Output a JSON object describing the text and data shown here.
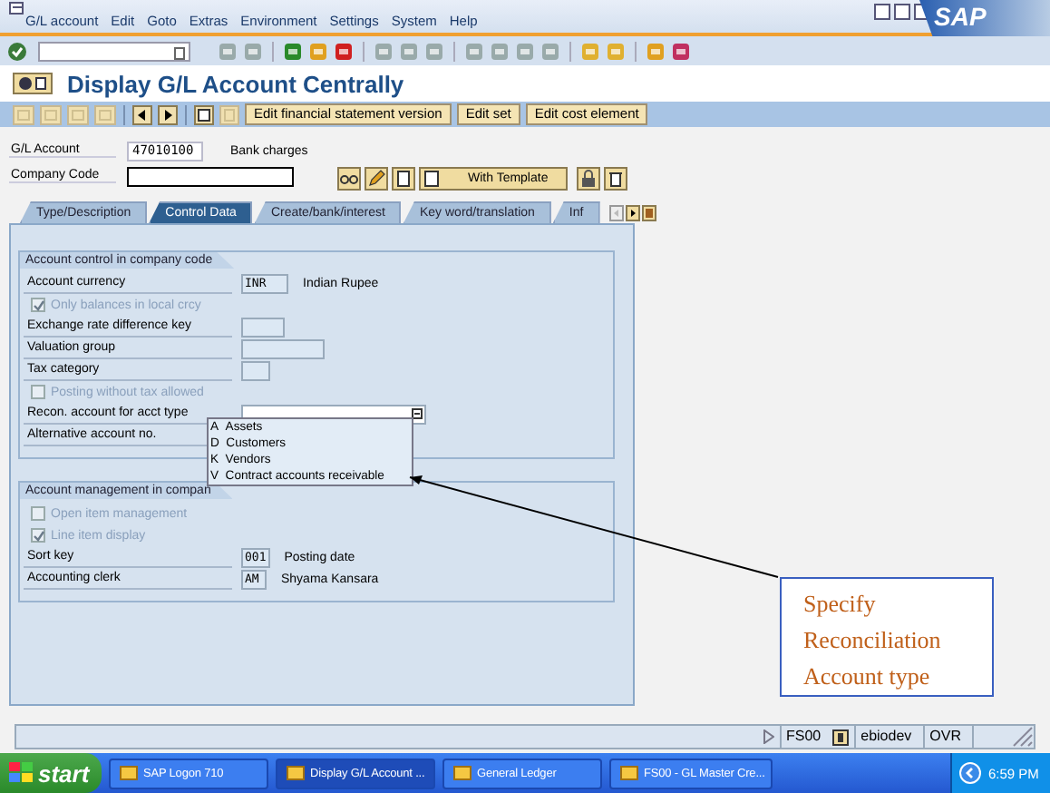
{
  "window": {
    "menu": [
      "G/L account",
      "Edit",
      "Goto",
      "Extras",
      "Environment",
      "Settings",
      "System",
      "Help"
    ],
    "logo": "SAP",
    "title": "Display G/L Account Centrally"
  },
  "app_toolbar": {
    "buttons": [
      "Edit financial statement version",
      "Edit set",
      "Edit cost element"
    ]
  },
  "header": {
    "account_label": "G/L Account",
    "account_value": "47010100",
    "account_name": "Bank charges",
    "company_code_label": "Company Code",
    "template_button": "With Template"
  },
  "tabs": [
    {
      "label": "Type/Description",
      "selected": false
    },
    {
      "label": "Control Data",
      "selected": true
    },
    {
      "label": "Create/bank/interest",
      "selected": false
    },
    {
      "label": "Key word/translation",
      "selected": false
    },
    {
      "label": "Inf",
      "selected": false
    }
  ],
  "sections": [
    {
      "title": "Account control in company code",
      "rows": [
        {
          "kind": "field",
          "label": "Account currency",
          "value": "INR",
          "description": "Indian Rupee"
        },
        {
          "kind": "checkbox",
          "label": "Only balances in local crcy",
          "checked": true,
          "disabled": true
        },
        {
          "kind": "field",
          "label": "Exchange rate difference key"
        },
        {
          "kind": "field",
          "label": "Valuation group"
        },
        {
          "kind": "field",
          "label": "Tax category"
        },
        {
          "kind": "checkbox",
          "label": "Posting without tax allowed",
          "checked": false,
          "disabled": true
        },
        {
          "kind": "combo",
          "label": "Recon. account for acct type"
        },
        {
          "kind": "text",
          "label": "Alternative account no."
        }
      ]
    },
    {
      "title": "Account management in compan",
      "rows": [
        {
          "kind": "checkbox",
          "label": "Open item management",
          "checked": false,
          "disabled": true
        },
        {
          "kind": "checkbox",
          "label": "Line item display",
          "checked": true,
          "disabled": true
        },
        {
          "kind": "field",
          "label": "Sort key",
          "value": "001",
          "description": "Posting date"
        },
        {
          "kind": "field",
          "label": "Accounting clerk",
          "value": "AM",
          "description": "Shyama Kansara"
        }
      ]
    }
  ],
  "dropdown": {
    "options": [
      {
        "key": "A",
        "text": "Assets"
      },
      {
        "key": "D",
        "text": "Customers"
      },
      {
        "key": "K",
        "text": "Vendors"
      },
      {
        "key": "V",
        "text": "Contract accounts receivable"
      }
    ]
  },
  "callout": {
    "text": "Specify Reconciliation Account type"
  },
  "status_bar": {
    "transaction": "FS00",
    "system": "ebiodev",
    "mode": "OVR"
  },
  "taskbar": {
    "start": "start",
    "items": [
      {
        "label": "SAP Logon 710",
        "selected": false
      },
      {
        "label": "Display G/L Account ...",
        "selected": true
      },
      {
        "label": "General Ledger",
        "selected": false
      },
      {
        "label": "FS00 - GL Master Cre...",
        "selected": false
      }
    ],
    "clock": "6:59 PM"
  }
}
